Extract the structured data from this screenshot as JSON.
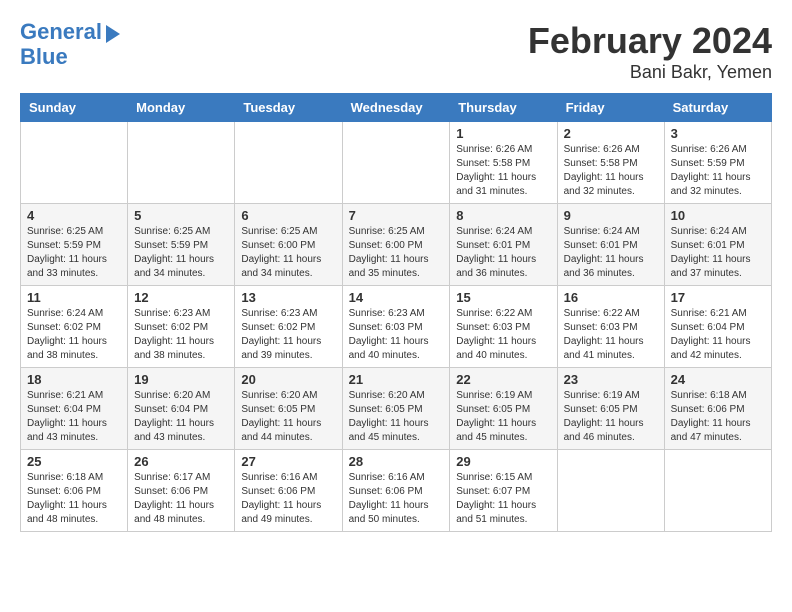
{
  "logo": {
    "line1": "General",
    "line2": "Blue"
  },
  "title": "February 2024",
  "location": "Bani Bakr, Yemen",
  "days_of_week": [
    "Sunday",
    "Monday",
    "Tuesday",
    "Wednesday",
    "Thursday",
    "Friday",
    "Saturday"
  ],
  "weeks": [
    [
      {
        "num": "",
        "info": ""
      },
      {
        "num": "",
        "info": ""
      },
      {
        "num": "",
        "info": ""
      },
      {
        "num": "",
        "info": ""
      },
      {
        "num": "1",
        "info": "Sunrise: 6:26 AM\nSunset: 5:58 PM\nDaylight: 11 hours\nand 31 minutes."
      },
      {
        "num": "2",
        "info": "Sunrise: 6:26 AM\nSunset: 5:58 PM\nDaylight: 11 hours\nand 32 minutes."
      },
      {
        "num": "3",
        "info": "Sunrise: 6:26 AM\nSunset: 5:59 PM\nDaylight: 11 hours\nand 32 minutes."
      }
    ],
    [
      {
        "num": "4",
        "info": "Sunrise: 6:25 AM\nSunset: 5:59 PM\nDaylight: 11 hours\nand 33 minutes."
      },
      {
        "num": "5",
        "info": "Sunrise: 6:25 AM\nSunset: 5:59 PM\nDaylight: 11 hours\nand 34 minutes."
      },
      {
        "num": "6",
        "info": "Sunrise: 6:25 AM\nSunset: 6:00 PM\nDaylight: 11 hours\nand 34 minutes."
      },
      {
        "num": "7",
        "info": "Sunrise: 6:25 AM\nSunset: 6:00 PM\nDaylight: 11 hours\nand 35 minutes."
      },
      {
        "num": "8",
        "info": "Sunrise: 6:24 AM\nSunset: 6:01 PM\nDaylight: 11 hours\nand 36 minutes."
      },
      {
        "num": "9",
        "info": "Sunrise: 6:24 AM\nSunset: 6:01 PM\nDaylight: 11 hours\nand 36 minutes."
      },
      {
        "num": "10",
        "info": "Sunrise: 6:24 AM\nSunset: 6:01 PM\nDaylight: 11 hours\nand 37 minutes."
      }
    ],
    [
      {
        "num": "11",
        "info": "Sunrise: 6:24 AM\nSunset: 6:02 PM\nDaylight: 11 hours\nand 38 minutes."
      },
      {
        "num": "12",
        "info": "Sunrise: 6:23 AM\nSunset: 6:02 PM\nDaylight: 11 hours\nand 38 minutes."
      },
      {
        "num": "13",
        "info": "Sunrise: 6:23 AM\nSunset: 6:02 PM\nDaylight: 11 hours\nand 39 minutes."
      },
      {
        "num": "14",
        "info": "Sunrise: 6:23 AM\nSunset: 6:03 PM\nDaylight: 11 hours\nand 40 minutes."
      },
      {
        "num": "15",
        "info": "Sunrise: 6:22 AM\nSunset: 6:03 PM\nDaylight: 11 hours\nand 40 minutes."
      },
      {
        "num": "16",
        "info": "Sunrise: 6:22 AM\nSunset: 6:03 PM\nDaylight: 11 hours\nand 41 minutes."
      },
      {
        "num": "17",
        "info": "Sunrise: 6:21 AM\nSunset: 6:04 PM\nDaylight: 11 hours\nand 42 minutes."
      }
    ],
    [
      {
        "num": "18",
        "info": "Sunrise: 6:21 AM\nSunset: 6:04 PM\nDaylight: 11 hours\nand 43 minutes."
      },
      {
        "num": "19",
        "info": "Sunrise: 6:20 AM\nSunset: 6:04 PM\nDaylight: 11 hours\nand 43 minutes."
      },
      {
        "num": "20",
        "info": "Sunrise: 6:20 AM\nSunset: 6:05 PM\nDaylight: 11 hours\nand 44 minutes."
      },
      {
        "num": "21",
        "info": "Sunrise: 6:20 AM\nSunset: 6:05 PM\nDaylight: 11 hours\nand 45 minutes."
      },
      {
        "num": "22",
        "info": "Sunrise: 6:19 AM\nSunset: 6:05 PM\nDaylight: 11 hours\nand 45 minutes."
      },
      {
        "num": "23",
        "info": "Sunrise: 6:19 AM\nSunset: 6:05 PM\nDaylight: 11 hours\nand 46 minutes."
      },
      {
        "num": "24",
        "info": "Sunrise: 6:18 AM\nSunset: 6:06 PM\nDaylight: 11 hours\nand 47 minutes."
      }
    ],
    [
      {
        "num": "25",
        "info": "Sunrise: 6:18 AM\nSunset: 6:06 PM\nDaylight: 11 hours\nand 48 minutes."
      },
      {
        "num": "26",
        "info": "Sunrise: 6:17 AM\nSunset: 6:06 PM\nDaylight: 11 hours\nand 48 minutes."
      },
      {
        "num": "27",
        "info": "Sunrise: 6:16 AM\nSunset: 6:06 PM\nDaylight: 11 hours\nand 49 minutes."
      },
      {
        "num": "28",
        "info": "Sunrise: 6:16 AM\nSunset: 6:06 PM\nDaylight: 11 hours\nand 50 minutes."
      },
      {
        "num": "29",
        "info": "Sunrise: 6:15 AM\nSunset: 6:07 PM\nDaylight: 11 hours\nand 51 minutes."
      },
      {
        "num": "",
        "info": ""
      },
      {
        "num": "",
        "info": ""
      }
    ]
  ]
}
